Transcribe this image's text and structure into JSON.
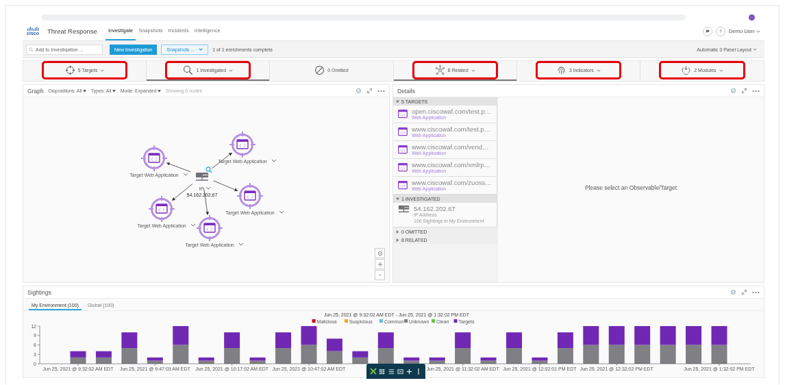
{
  "header": {
    "logo_text": "cisco",
    "app_title": "Threat Response",
    "nav": [
      {
        "label": "Investigate",
        "selected": true
      },
      {
        "label": "Snapshots",
        "selected": false
      },
      {
        "label": "Incidents",
        "selected": false
      },
      {
        "label": "Intelligence",
        "selected": false
      }
    ],
    "user": "Demo User"
  },
  "toolbar": {
    "search": {
      "placeholder": "Add to Investigation ..."
    },
    "new_button": "New Investigation",
    "snapshots_button": "Snapshots ...",
    "status": "1 of 1 enrichments complete",
    "layout": "Automatic 3 Panel Layout"
  },
  "summary_tabs": [
    {
      "kind": "targets",
      "label": "5 Targets",
      "dropdown": true,
      "selected": false,
      "highlighted": true
    },
    {
      "kind": "investigated",
      "label": "1 Investigated",
      "dropdown": true,
      "selected": true,
      "highlighted": true
    },
    {
      "kind": "omitted",
      "label": "0 Omitted",
      "dropdown": false,
      "selected": false,
      "highlighted": false
    },
    {
      "kind": "related",
      "label": "8 Related",
      "dropdown": true,
      "selected": true,
      "highlighted": true
    },
    {
      "kind": "indicators",
      "label": "3 Indicators",
      "dropdown": true,
      "selected": false,
      "highlighted": true
    },
    {
      "kind": "modules",
      "label": "2 Modules",
      "dropdown": true,
      "selected": false,
      "highlighted": true
    }
  ],
  "graph": {
    "title": "Graph",
    "filters": [
      "Dispositions: All",
      "Types: All",
      "Mode: Expanded"
    ],
    "node_count": "Showing 6 nodes",
    "center": {
      "type": "IP",
      "value": "54.162.202.67"
    },
    "nodes": [
      {
        "label": "Target Web Application"
      },
      {
        "label": "Target Web Application"
      },
      {
        "label": "Target Web Application"
      },
      {
        "label": "Target Web Application"
      },
      {
        "label": "Target Web Application"
      }
    ]
  },
  "details": {
    "title": "Details",
    "sections": [
      {
        "label": "5 TARGETS",
        "expanded": true,
        "items": [
          {
            "kind": "web",
            "title": "open.ciscowaf.com/test.p…",
            "subtitle": "Web Application"
          },
          {
            "kind": "web",
            "title": "www.ciscowaf.com/test.p…",
            "subtitle": "Web Application"
          },
          {
            "kind": "web",
            "title": "www.ciscowaf.com/vend…",
            "subtitle": "Web Application"
          },
          {
            "kind": "web",
            "title": "www.ciscowaf.com/xmlrp…",
            "subtitle": "Web Application"
          },
          {
            "kind": "web",
            "title": "www.ciscowaf.com/zuoss…",
            "subtitle": "Web Application"
          }
        ]
      },
      {
        "label": "1 INVESTIGATED",
        "expanded": true,
        "items": [
          {
            "kind": "ip",
            "title": "54.162.202.67",
            "subtitle": "IP Address",
            "note": "100 Sightings in My Environment"
          }
        ]
      },
      {
        "label": "0 OMITTED",
        "expanded": false
      },
      {
        "label": "8 RELATED",
        "expanded": false
      }
    ],
    "message": "Please select an Observable/Target"
  },
  "sightings": {
    "title": "Sightings",
    "tabs": [
      {
        "label": "My Environment (100)",
        "selected": true
      },
      {
        "label": "Global (100)",
        "selected": false
      }
    ],
    "chart_data": {
      "type": "bar",
      "title": "Jun 25, 2021 @ 9:32:02 AM EDT - Jun 25, 2021 @ 1:32:02 PM EDT",
      "stacked": true,
      "categories": [
        "Jun 25, 2021 @ 9:32:02 AM EDT",
        null,
        null,
        "Jun 25, 2021 @ 9:47:03 AM EDT",
        null,
        null,
        "Jun 25, 2021 @ 10:17:02 AM EDT",
        null,
        null,
        "Jun 25, 2021 @ 10:47:02 AM EDT",
        null,
        null,
        null,
        null,
        null,
        "Jun 25, 2021 @ 11:32:02 AM EDT",
        null,
        null,
        "Jun 25, 2021 @ 12:02:01 PM EDT",
        null,
        null,
        "Jun 25, 2021 @ 12:32:02 PM EDT",
        null,
        null,
        null,
        "Jun 25, 2021 @ 1:32:02 PM EDT"
      ],
      "ylim": [
        0,
        12
      ],
      "yticks": [
        0,
        3,
        6,
        9,
        12
      ],
      "legend": "top",
      "series": [
        {
          "name": "Malicious",
          "color": "#d0021b",
          "values": [
            0,
            0,
            0,
            0,
            0,
            0,
            0,
            0,
            0,
            0,
            0,
            0,
            0,
            0,
            0,
            0,
            0,
            0,
            0,
            0,
            0,
            0,
            0,
            0,
            0,
            0
          ]
        },
        {
          "name": "Suspicious",
          "color": "#f5a623",
          "values": [
            0,
            0,
            0,
            0,
            0,
            0,
            0,
            0,
            0,
            0,
            0,
            0,
            0,
            0,
            0,
            0,
            0,
            0,
            0,
            0,
            0,
            0,
            0,
            0,
            0,
            0
          ]
        },
        {
          "name": "Common",
          "color": "#64bbe3",
          "values": [
            0,
            0,
            0,
            0,
            0,
            0,
            0,
            0,
            0,
            0,
            0,
            0,
            0,
            0,
            0,
            0,
            0,
            0,
            0,
            0,
            0,
            0,
            0,
            0,
            0,
            0
          ]
        },
        {
          "name": "Unknown",
          "color": "#7f7f84",
          "values": [
            2,
            2,
            5,
            1,
            6,
            1,
            5,
            1,
            5,
            6,
            4,
            2,
            5,
            1,
            1,
            5,
            1,
            5,
            1,
            5,
            6,
            6,
            6,
            6,
            6,
            6
          ]
        },
        {
          "name": "Clean",
          "color": "#6cc04a",
          "values": [
            0,
            0,
            0,
            0,
            0,
            0,
            0,
            0,
            0,
            0,
            0,
            0,
            0,
            0,
            0,
            0,
            0,
            0,
            0,
            0,
            0,
            0,
            0,
            0,
            0,
            0
          ]
        },
        {
          "name": "Targets",
          "color": "#7028b4",
          "values": [
            2,
            2,
            5,
            1,
            6,
            1,
            5,
            1,
            5,
            6,
            4,
            2,
            5,
            1,
            1,
            5,
            1,
            5,
            1,
            5,
            6,
            6,
            6,
            6,
            6,
            6
          ]
        }
      ]
    }
  }
}
